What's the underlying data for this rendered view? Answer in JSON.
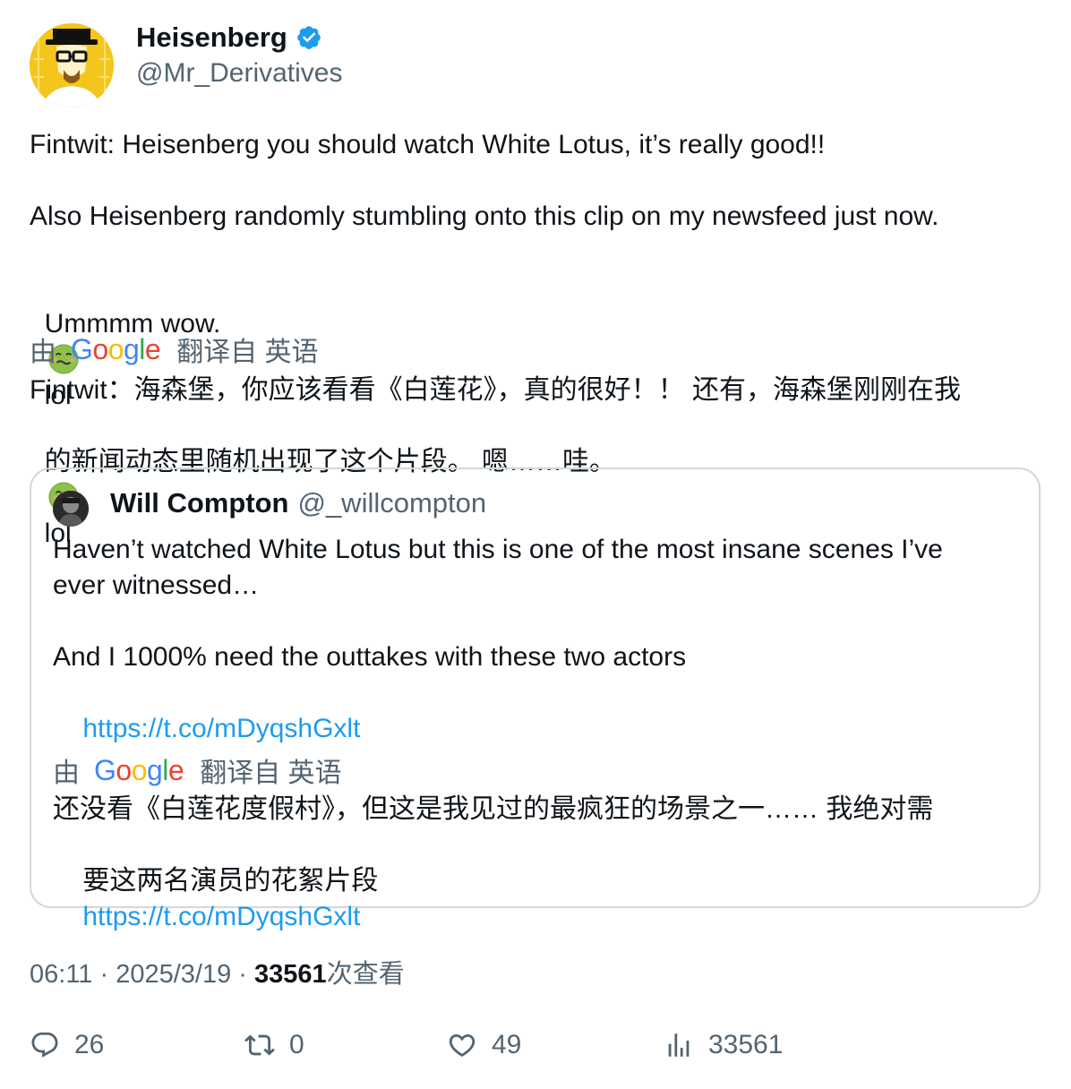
{
  "author": {
    "name": "Heisenberg",
    "handle": "@Mr_Derivatives"
  },
  "tweet": {
    "para1": "Fintwit: Heisenberg you should watch White Lotus, it’s really good!!",
    "para2": "Also Heisenberg randomly stumbling onto this clip on my newsfeed just now.",
    "para3_before": "Ummmm wow.",
    "para3_after": "lol",
    "emoji": "nauseated-face-icon"
  },
  "translation": {
    "by": "由",
    "google": "Google",
    "from": "翻译自 英语",
    "line1": "Fintwit：海森堡，你应该看看《白莲花》，真的很好！！ 还有，海森堡刚刚在我",
    "line2_before": "的新闻动态里随机出现了这个片段。 嗯……哇。",
    "line2_after": "lol"
  },
  "quote": {
    "name": "Will Compton",
    "handle": "@_willcompton",
    "line1": "Haven’t watched White Lotus but this is one of the most insane scenes I’ve",
    "line2": "ever witnessed…",
    "line3": "And I 1000% need the outtakes with these two actors",
    "link": "https://t.co/mDyqshGxlt",
    "trans_by": "由",
    "trans_google": "Google",
    "trans_from": "翻译自 英语",
    "trans_line1": "还没看《白莲花度假村》，但这是我见过的最疯狂的场景之一…… 我绝对需",
    "trans_line2": "要这两名演员的花絮片段",
    "trans_link": "https://t.co/mDyqshGxlt"
  },
  "meta": {
    "time": "06:11",
    "sep1": "·",
    "date": "2025/3/19",
    "sep2": "·",
    "views": "33561",
    "views_label": "次查看"
  },
  "actions": {
    "replies": "26",
    "retweets": "0",
    "likes": "49",
    "views": "33561"
  },
  "colors": {
    "link": "#1d9bf0",
    "secondary": "#536471",
    "verified": "#1d9bf0"
  }
}
